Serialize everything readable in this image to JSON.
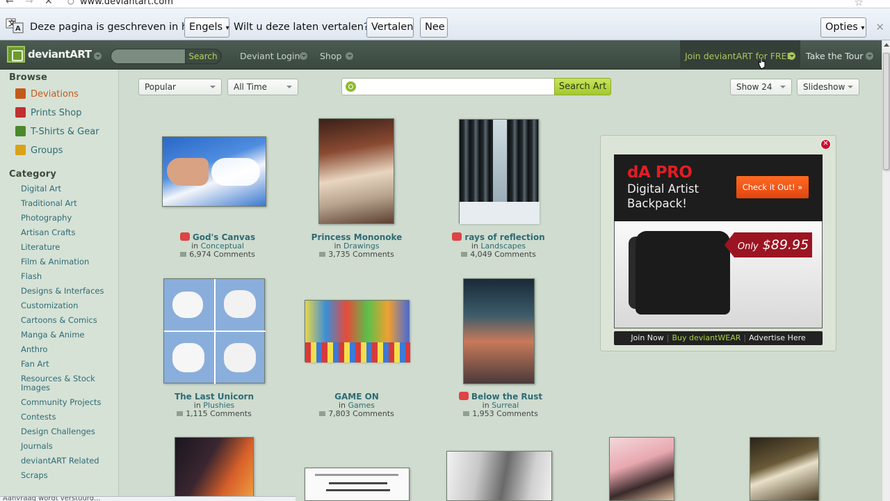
{
  "browser": {
    "url": "www.deviantart.com"
  },
  "translate_bar": {
    "message_pre": "Deze pagina is geschreven in het",
    "language": "Engels",
    "question": "Wilt u deze laten vertalen?",
    "translate_btn": "Vertalen",
    "no_btn": "Nee",
    "options_btn": "Opties"
  },
  "header": {
    "logo": "deviantART",
    "search_btn": "Search",
    "login": "Deviant Login",
    "shop": "Shop",
    "join": "Join deviantART for FREE",
    "tour": "Take the Tour"
  },
  "sidebar": {
    "browse_title": "Browse",
    "browse": [
      {
        "label": "Deviations",
        "color": "#c45a1a"
      },
      {
        "label": "Prints Shop",
        "color": "#c03030"
      },
      {
        "label": "T-Shirts & Gear",
        "color": "#4a8a2a"
      },
      {
        "label": "Groups",
        "color": "#d8a21a"
      }
    ],
    "category_title": "Category",
    "categories": [
      "Digital Art",
      "Traditional Art",
      "Photography",
      "Artisan Crafts",
      "Literature",
      "Film & Animation",
      "Flash",
      "Designs & Interfaces",
      "Customization",
      "Cartoons & Comics",
      "Manga & Anime",
      "Anthro",
      "Fan Art",
      "Resources & Stock Images",
      "Community Projects",
      "Contests",
      "Design Challenges",
      "Journals",
      "deviantART Related",
      "Scraps"
    ]
  },
  "toolbar": {
    "sort": "Popular",
    "time": "All Time",
    "search_placeholder": "",
    "search_btn": "Search Art",
    "show": "Show 24",
    "slideshow": "Slideshow"
  },
  "thumbs": [
    {
      "title": "God's Canvas",
      "in_label": "in",
      "category": "Conceptual",
      "comments": "6,974 Comments",
      "red_icon": true
    },
    {
      "title": "Princess Mononoke",
      "in_label": "in",
      "category": "Drawings",
      "comments": "3,735 Comments",
      "red_icon": false
    },
    {
      "title": "rays of reflection",
      "in_label": "in",
      "category": "Landscapes",
      "comments": "4,049 Comments",
      "red_icon": true
    },
    {
      "title": "The Last Unicorn",
      "in_label": "in",
      "category": "Plushies",
      "comments": "1,115 Comments",
      "red_icon": false
    },
    {
      "title": "GAME ON",
      "in_label": "in",
      "category": "Games",
      "comments": "7,803 Comments",
      "red_icon": false
    },
    {
      "title": "Below the Rust",
      "in_label": "in",
      "category": "Surreal",
      "comments": "1,953 Comments",
      "red_icon": true
    }
  ],
  "ad": {
    "brand": "dA PRO",
    "line1": "Digital Artist",
    "line2": "Backpack!",
    "cta": "Check it Out! »",
    "price_pre": "Only",
    "price": "$89.95",
    "foot_join": "Join Now",
    "foot_buy": "Buy deviantWEAR",
    "foot_adv": "Advertise Here"
  },
  "status_text": "Aanvraag wordt verstuurd..."
}
